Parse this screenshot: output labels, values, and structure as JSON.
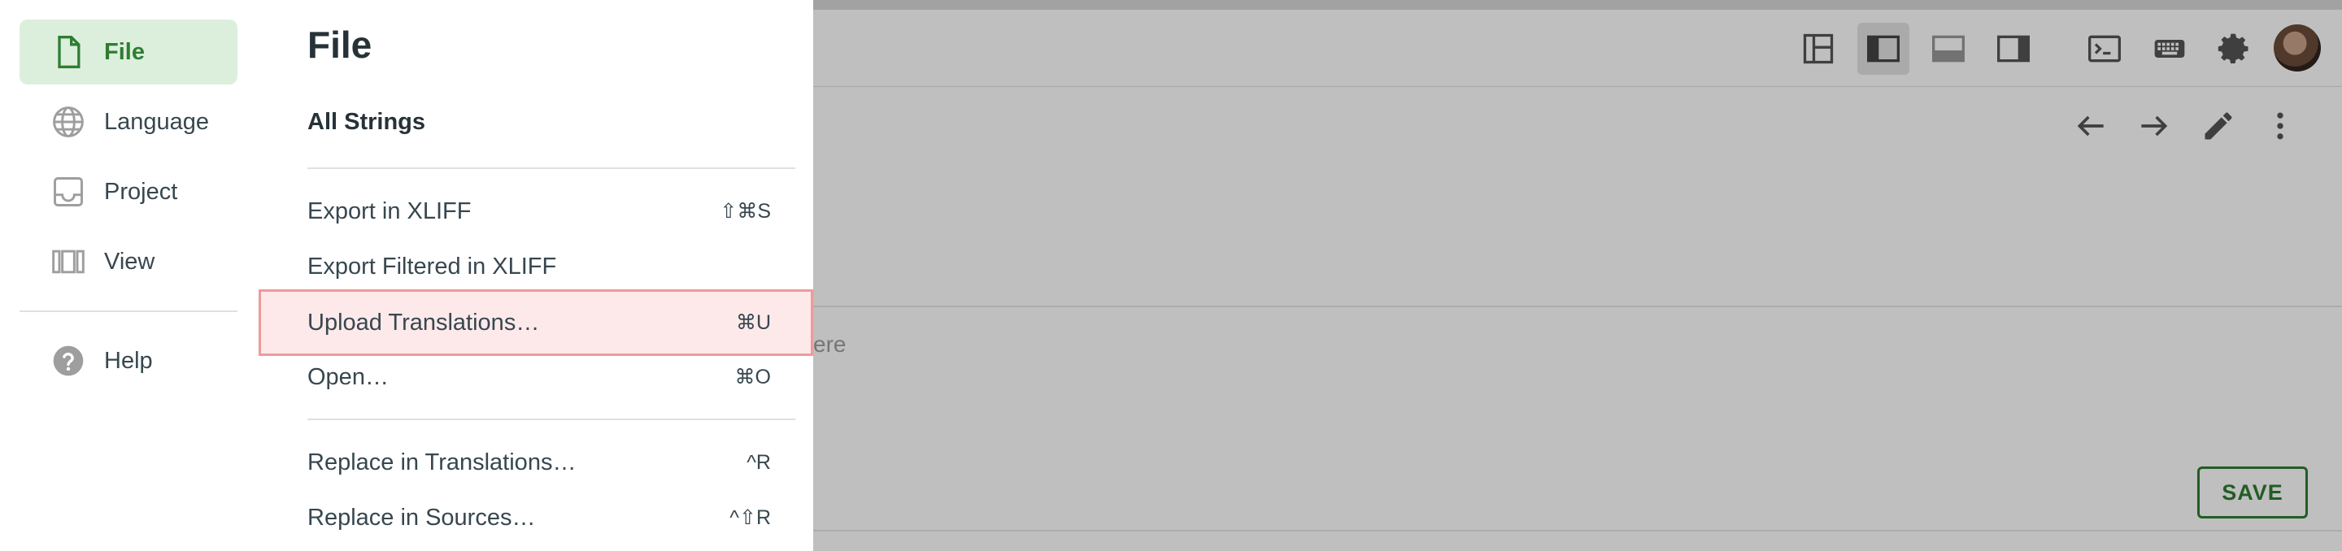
{
  "sidebar": {
    "items": [
      {
        "label": "File",
        "icon": "file-icon",
        "active": true
      },
      {
        "label": "Language",
        "icon": "globe-icon",
        "active": false
      },
      {
        "label": "Project",
        "icon": "inbox-icon",
        "active": false
      },
      {
        "label": "View",
        "icon": "view-columns-icon",
        "active": false
      }
    ],
    "help": {
      "label": "Help",
      "icon": "help-icon"
    }
  },
  "file_menu": {
    "title": "File",
    "all_strings": "All Strings",
    "items": [
      {
        "label": "Export in XLIFF",
        "shortcut": "⇧⌘S"
      },
      {
        "label": "Export Filtered in XLIFF",
        "shortcut": ""
      },
      {
        "label": "Upload Translations…",
        "shortcut": "⌘U",
        "highlighted": true
      },
      {
        "label": "Open…",
        "shortcut": "⌘O"
      },
      {
        "label": "Replace in Translations…",
        "shortcut": "^R"
      },
      {
        "label": "Replace in Sources…",
        "shortcut": "^⇧R"
      }
    ]
  },
  "editor": {
    "placeholder_fragment": "ere",
    "save_label": "SAVE",
    "toolbar_icons": [
      "layout-grid-icon",
      "sidebar-left-icon",
      "panel-bottom-icon",
      "sidebar-right-icon",
      "terminal-icon",
      "keyboard-icon",
      "gear-icon",
      "avatar"
    ],
    "actions": [
      "arrow-left-icon",
      "arrow-right-icon",
      "pencil-icon",
      "more-vertical-icon"
    ]
  },
  "colors": {
    "accent_green": "#2e7d32",
    "active_bg": "#dcefdc",
    "highlight_bg": "#fde9ea",
    "highlight_border": "#ef9a9a"
  }
}
